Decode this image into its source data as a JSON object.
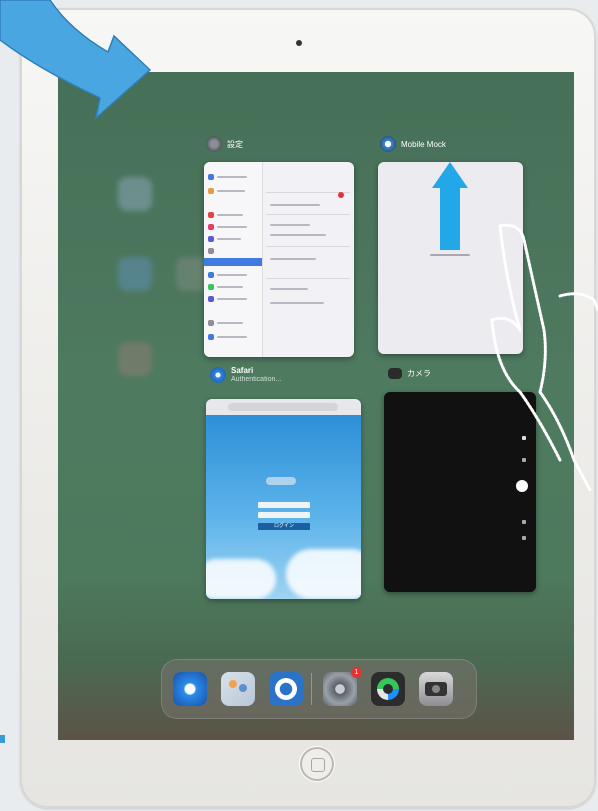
{
  "app_switcher": {
    "cards": [
      {
        "app": "設定",
        "icon": "settings-icon"
      },
      {
        "app": "Mobile Mock",
        "icon": "app-icon"
      },
      {
        "app": "Safari",
        "subtitle": "Authentication...",
        "icon": "safari-icon"
      },
      {
        "app": "カメラ",
        "icon": "camera-icon"
      }
    ],
    "safari_button_label": "ログイン"
  },
  "dock": {
    "apps": [
      "safari-icon",
      "contacts-icon",
      "help-icon",
      "settings-icon",
      "find-my-icon",
      "camera-icon"
    ],
    "settings_badge": "1"
  },
  "colors": {
    "annotation_arrow": "#4aa6e0",
    "swipe_up_arrow": "#22a7e8",
    "screen_green": "#4e7a60"
  }
}
